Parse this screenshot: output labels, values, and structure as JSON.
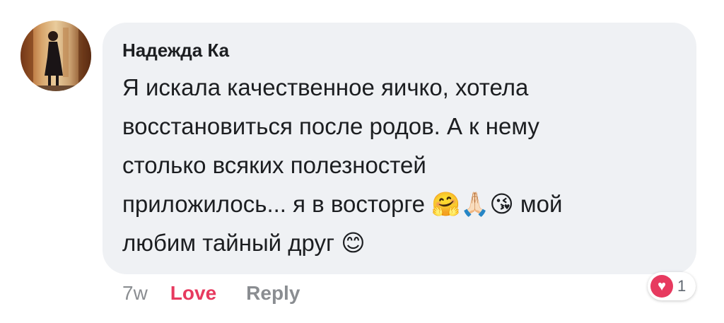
{
  "comment": {
    "author": "Надежда Ка",
    "text": "Я искала качественное яичко, хотела\nвосстановиться после родов. А к нему\nстолько всяких полезностей\nприложилось... я в восторге 🤗🙏🏻😘 мой\nлюбим тайный друг 😊",
    "time": "7w",
    "love_label": "Love",
    "reply_label": "Reply",
    "reaction": {
      "icon": "heart-icon",
      "count": "1",
      "color": "#e73a5f"
    }
  }
}
